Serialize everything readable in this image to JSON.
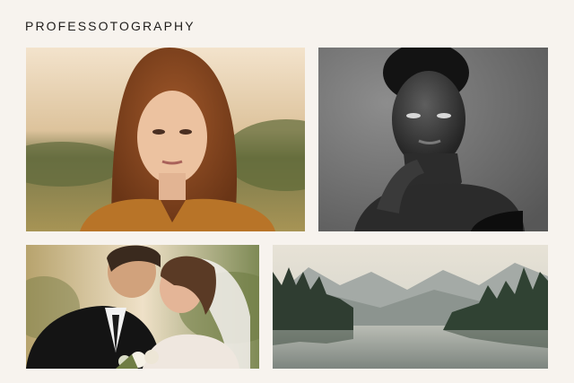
{
  "brand": {
    "name": "PROFESSOTOGRAPHY"
  },
  "gallery": {
    "photos": [
      {
        "subject": "warm-toned portrait of a woman with wavy auburn hair in a field",
        "palette": "#c8893c"
      },
      {
        "subject": "black and white studio portrait of a woman with hand near chin",
        "palette": "#555555"
      },
      {
        "subject": "wedding couple embracing, bride in veil, groom in black suit",
        "palette": "#e9ddd0"
      },
      {
        "subject": "misty mountain lake landscape with pine trees",
        "palette": "#8f9a94"
      }
    ]
  }
}
